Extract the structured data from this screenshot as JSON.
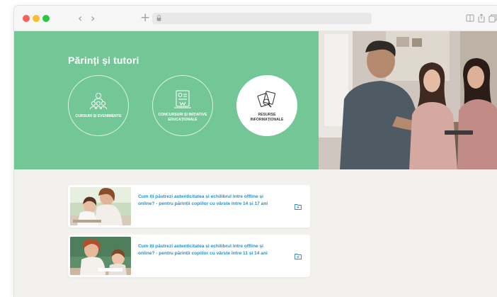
{
  "browser": {
    "nav": {
      "back": "‹",
      "forward": "›",
      "new_tab": "+"
    }
  },
  "hero": {
    "title": "Părinți și tutori",
    "background_color": "#73c797",
    "categories": [
      {
        "label": "CURSURI ȘI EVENIMENTE",
        "icon": "people-group-icon",
        "selected": false
      },
      {
        "label": "CONCURSURI ȘI INIȚIATIVE EDUCAȚIONALE",
        "icon": "trophy-certificate-icon",
        "selected": false
      },
      {
        "label": "RESURSE INFORMAȚIONALE",
        "icon": "documents-magnifier-icon",
        "selected": true
      }
    ]
  },
  "resources": [
    {
      "title": "Cum îți păstrezi autenticitatea și echilibrul între offline și online? - pentru părinții copiilor cu vârste între 14 și 17 ani",
      "icon": "folder-icon"
    },
    {
      "title": "Cum îți păstrezi autenticitatea și echilibrul între offline și online? - pentru părinții copiilor cu vârste între 11 și 14 ani",
      "icon": "folder-icon"
    }
  ],
  "colors": {
    "accent": "#73c797",
    "link": "#2d8fc4",
    "page_bg": "#f2f1ee"
  }
}
